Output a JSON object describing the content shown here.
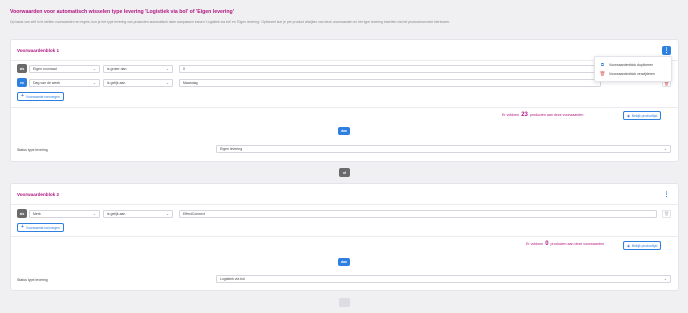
{
  "header": {
    "title": "Voorwaarden voor automatisch wisselen type levering 'Logistiek via bol' of 'Eigen levering'",
    "subtitle": "Op basis van zelf in te stellen voorwaarden en regels, kun je het type levering van producten automatisch laten aanpassen tussen 'Logistiek via bol' en 'Eigen levering'. Optioneel kun je per product afwijken van deze voorwaarden en het type levering instellen via het productoverzicht hierboven."
  },
  "blocks": [
    {
      "title": "Voorwaardenblok 1",
      "conditions": [
        {
          "tag": "als",
          "field": "Eigen voorraad",
          "operator": "is groter dan",
          "value": "0"
        },
        {
          "tag": "en",
          "field": "Dag van de week",
          "operator": "is gelijk aan",
          "value": "Maandag"
        }
      ],
      "add_label": "Voorwaarde toevoegen",
      "summary_prefix": "Er voldoen",
      "summary_count": "23",
      "summary_suffix": "producten aan deze voorwaarden",
      "view_label": "Bekijk productlijst",
      "then_label": "dan",
      "status_label": "Status type levering",
      "status_value": "Eigen levering"
    },
    {
      "title": "Voorwaardenblok 2",
      "conditions": [
        {
          "tag": "als",
          "field": "Merk",
          "operator": "is gelijk aan",
          "value": "EffectConnect"
        }
      ],
      "add_label": "Voorwaarde toevoegen",
      "summary_prefix": "Er voldoen",
      "summary_count": "0",
      "summary_suffix": "producten aan deze voorwaarden",
      "view_label": "Bekijk productlijst",
      "then_label": "dan",
      "status_label": "Status type levering",
      "status_value": "Logistiek via bol"
    }
  ],
  "separator_label": "of",
  "menu": {
    "items": [
      {
        "label": "Voorwaardenblok dupliceren",
        "icon": "copy-icon"
      },
      {
        "label": "Voorwaardenblok verwijderen",
        "icon": "trash-icon"
      }
    ]
  },
  "colors": {
    "accent": "#2d7fe0",
    "title": "#b0167f",
    "tag_dark": "#6a6a6a"
  }
}
